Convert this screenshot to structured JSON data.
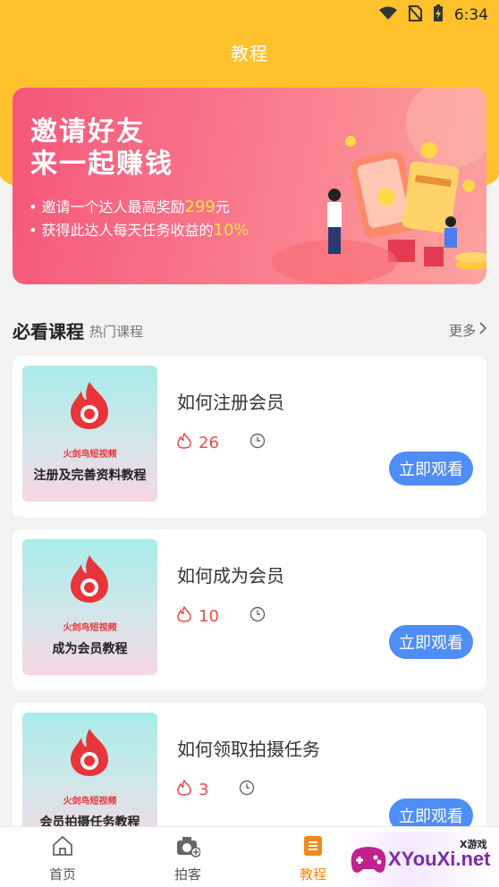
{
  "status_bar": {
    "time": "6:34",
    "icons": [
      "wifi-icon",
      "no-sim-icon",
      "battery-charging-icon"
    ]
  },
  "header": {
    "title": "教程"
  },
  "banner": {
    "line1": "邀请好友",
    "line2": "来一起赚钱",
    "bullet1_prefix": "• 邀请一个达人最高奖励",
    "bullet1_value": "299",
    "bullet1_suffix": "元",
    "bullet2_prefix": "• 获得此达人每天任务收益的",
    "bullet2_value": "10%"
  },
  "section": {
    "title": "必看课程",
    "subtitle": "热门课程",
    "more_label": "更多"
  },
  "courses": [
    {
      "title": "如何注册会员",
      "count": "26",
      "thumb_brand": "火剑鸟短视频",
      "thumb_caption": "注册及完善资料教程",
      "button": "立即观看"
    },
    {
      "title": "如何成为会员",
      "count": "10",
      "thumb_brand": "火剑鸟短视频",
      "thumb_caption": "成为会员教程",
      "button": "立即观看"
    },
    {
      "title": "如何领取拍摄任务",
      "count": "3",
      "thumb_brand": "火剑鸟短视频",
      "thumb_caption": "会员拍摄任务教程",
      "button": "立即观看"
    }
  ],
  "tabbar": {
    "items": [
      {
        "label": "首页",
        "icon": "home-icon"
      },
      {
        "label": "拍客",
        "icon": "camera-icon"
      },
      {
        "label": "教程",
        "icon": "document-icon",
        "active": true
      }
    ]
  },
  "watermark": {
    "text": "XYouXi.net",
    "small": "X游戏"
  },
  "colors": {
    "header_bg": "#ffc22d",
    "accent_button": "#4f8df6",
    "active_tab": "#f08a1c",
    "count_red": "#e84c4c"
  }
}
